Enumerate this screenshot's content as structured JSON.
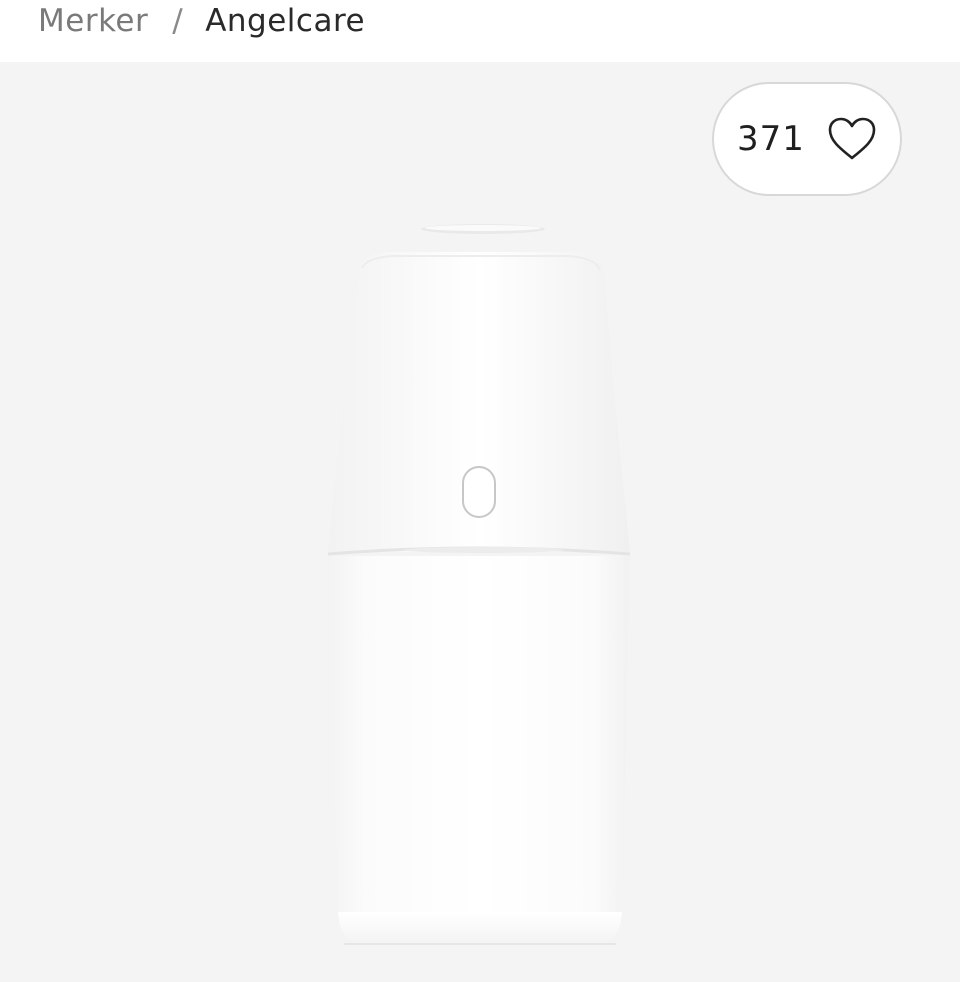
{
  "breadcrumb": {
    "parent_label": "Merker",
    "separator": "/",
    "current_label": "Angelcare"
  },
  "likes": {
    "count": "371",
    "icon": "heart-outline-icon"
  },
  "product": {
    "image": "diaper-bin-image"
  },
  "colors": {
    "product_area_bg": "#f4f4f4",
    "text_primary": "#2a2a2a",
    "text_secondary": "#7a7a7a"
  }
}
